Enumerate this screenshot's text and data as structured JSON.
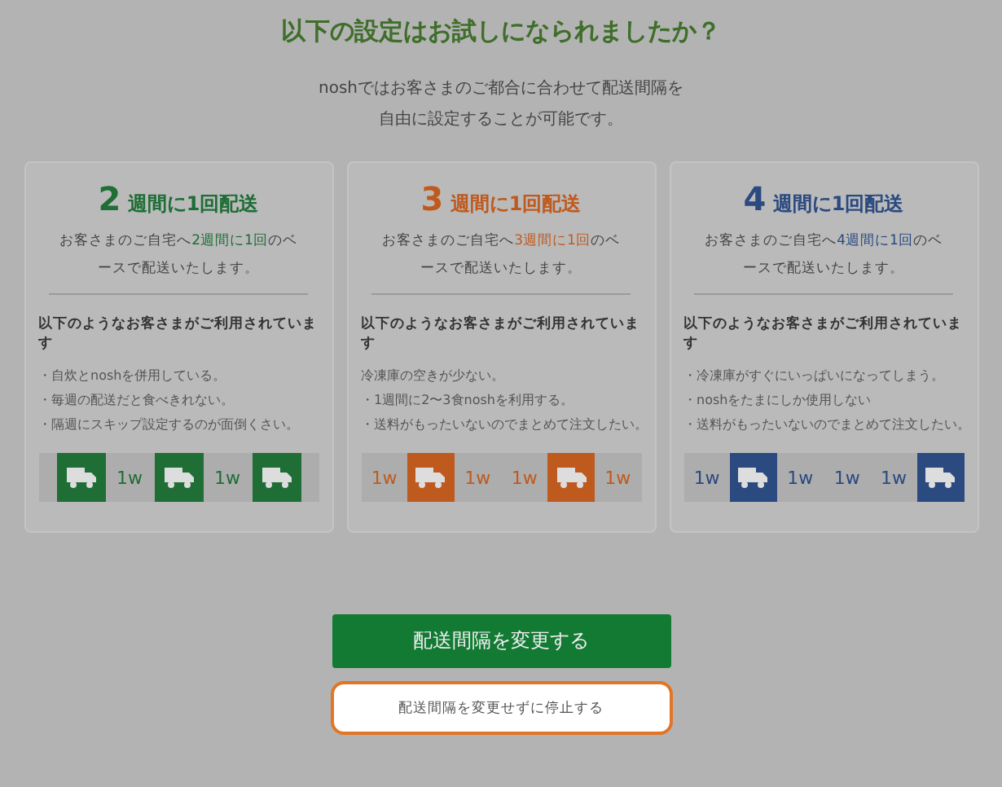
{
  "heading": "以下の設定はお試しになられましたか？",
  "intro": [
    "noshではお客さまのご都合に合わせて配送間隔を",
    "自由に設定することが可能です。"
  ],
  "plans": [
    {
      "number": "2",
      "title": "週間に1回配送",
      "color": "#1f6e36",
      "desc_before": "お客さまのご自宅へ",
      "desc_highlight": "2週間に1回",
      "desc_after": "のベースで配送いたします。",
      "users_heading": "以下のようなお客さまがご利用されています",
      "users": [
        "・自炊とnoshを併用している。",
        "・毎週の配送だと食べきれない。",
        "・隔週にスキップ設定するのが面倒くさい。"
      ],
      "schedule": [
        {
          "kind": "truck"
        },
        {
          "kind": "week",
          "label": "1w"
        },
        {
          "kind": "truck"
        },
        {
          "kind": "week",
          "label": "1w"
        },
        {
          "kind": "truck"
        }
      ]
    },
    {
      "number": "3",
      "title": "週間に1回配送",
      "color": "#bf5a1f",
      "desc_before": "お客さまのご自宅へ",
      "desc_highlight": "3週間に1回",
      "desc_after": "のベースで配送いたします。",
      "users_heading": "以下のようなお客さまがご利用されています",
      "users": [
        "冷凍庫の空きが少ない。",
        "・1週間に2〜3食noshを利用する。",
        "・送料がもったいないのでまとめて注文したい。"
      ],
      "schedule": [
        {
          "kind": "week",
          "label": "1w"
        },
        {
          "kind": "truck"
        },
        {
          "kind": "week",
          "label": "1w"
        },
        {
          "kind": "week",
          "label": "1w"
        },
        {
          "kind": "truck"
        },
        {
          "kind": "week",
          "label": "1w"
        }
      ]
    },
    {
      "number": "4",
      "title": "週間に1回配送",
      "color": "#2b4a80",
      "desc_before": "お客さまのご自宅へ",
      "desc_highlight": "4週間に1回",
      "desc_after": "のベースで配送いたします。",
      "users_heading": "以下のようなお客さまがご利用されています",
      "users": [
        "・冷凍庫がすぐにいっぱいになってしまう。",
        "・noshをたまにしか使用しない",
        "・送料がもったいないのでまとめて注文したい。"
      ],
      "schedule": [
        {
          "kind": "week",
          "label": "1w"
        },
        {
          "kind": "truck"
        },
        {
          "kind": "week",
          "label": "1w"
        },
        {
          "kind": "week",
          "label": "1w"
        },
        {
          "kind": "week",
          "label": "1w"
        },
        {
          "kind": "truck"
        }
      ]
    }
  ],
  "primary_button": "配送間隔を変更する",
  "secondary_button": "配送間隔を変更せずに停止する"
}
